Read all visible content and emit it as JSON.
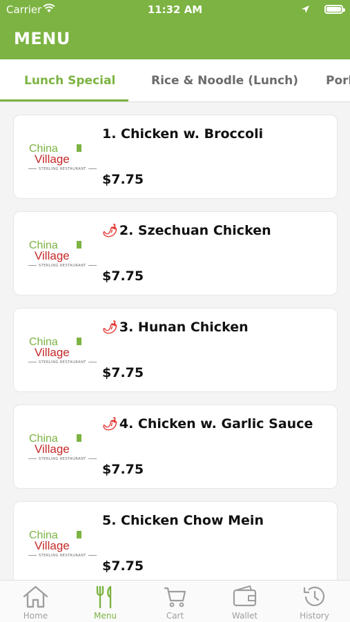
{
  "status_bar": {
    "carrier": "Carrier",
    "time": "11:32 AM"
  },
  "header": {
    "title": "MENU"
  },
  "tabs": [
    {
      "label": "Lunch Special",
      "active": true
    },
    {
      "label": "Rice & Noodle (Lunch)",
      "active": false
    },
    {
      "label": "Pork",
      "active": false
    }
  ],
  "logo": {
    "line1": "China",
    "line2": "Village",
    "tagline": "STERLING RESTAURANT"
  },
  "items": [
    {
      "name": "1. Chicken w. Broccoli",
      "price": "$7.75",
      "spicy": false
    },
    {
      "name": "2. Szechuan Chicken",
      "price": "$7.75",
      "spicy": true
    },
    {
      "name": "3. Hunan Chicken",
      "price": "$7.75",
      "spicy": true
    },
    {
      "name": "4. Chicken w. Garlic Sauce",
      "price": "$7.75",
      "spicy": true
    },
    {
      "name": "5. Chicken Chow Mein",
      "price": "$7.75",
      "spicy": false
    }
  ],
  "bottom_nav": [
    {
      "label": "Home",
      "icon": "home-icon",
      "active": false
    },
    {
      "label": "Menu",
      "icon": "fork-knife-icon",
      "active": true
    },
    {
      "label": "Cart",
      "icon": "cart-icon",
      "active": false
    },
    {
      "label": "Wallet",
      "icon": "wallet-icon",
      "active": false
    },
    {
      "label": "History",
      "icon": "history-icon",
      "active": false
    }
  ],
  "colors": {
    "brand_green": "#7cb342",
    "logo_red": "#c62828",
    "chili_red": "#e53935"
  }
}
